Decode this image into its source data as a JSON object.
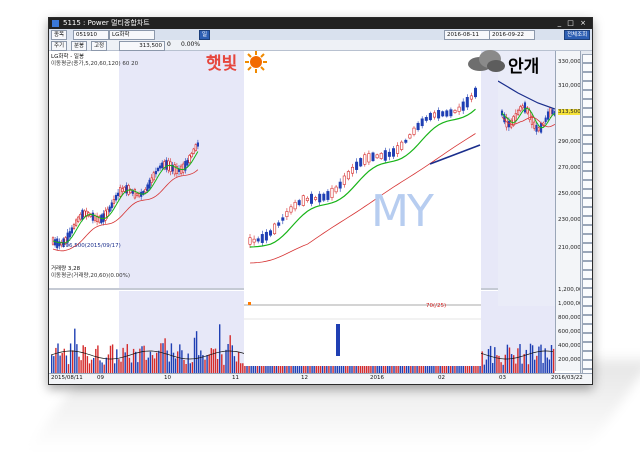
{
  "window": {
    "title": "5115 : Power 멀티종합차트",
    "controls": "_ □ ×"
  },
  "toolbar": {
    "mode": "종목",
    "code": "051910",
    "name": "LG화학",
    "period": "일",
    "price_label": "313,500",
    "change": "0",
    "change_pct": "0.00%",
    "dates_from": "2016-08-11",
    "dates_to": "2016-09-22",
    "btn_right": "전체조회",
    "sub_label1": "주기",
    "sub_label2": "분봉",
    "sub_label3": "고정"
  },
  "panels": {
    "price_title": "LG화학 - 일봉",
    "ma_legend": "이동평균(종가,5,20,60,120) 60 20",
    "low_note": "206,500(2015/09/17)",
    "volume_title": "거래량 3,28",
    "volume_sub": "이동평균(거래량,20,60)(0.00%)",
    "volume_red_label": "70(/25)"
  },
  "overlay": {
    "sunny_word": "햇빛",
    "foggy_word": "안개",
    "watermark": "MY"
  },
  "right_axis": {
    "price_ticks": [
      "330,000",
      "310,000",
      "290,000",
      "270,000",
      "250,000",
      "230,000",
      "210,000"
    ],
    "current_price": "313,500",
    "volume_ticks": [
      "1,200,000",
      "1,000,000",
      "800,000",
      "600,000",
      "400,000",
      "200,000"
    ]
  },
  "x_axis": {
    "ticks": [
      "2015/08/11",
      "09",
      "10",
      "11",
      "12",
      "2016",
      "02",
      "03",
      "2016/03/22"
    ]
  },
  "colors": {
    "up": "#d52b2b",
    "down": "#1f3fb3",
    "ma_green": "#18b418",
    "ma_red": "#d63434",
    "ma_navy": "#1a2e8c",
    "panel_bg": "#e7e8f8"
  }
}
